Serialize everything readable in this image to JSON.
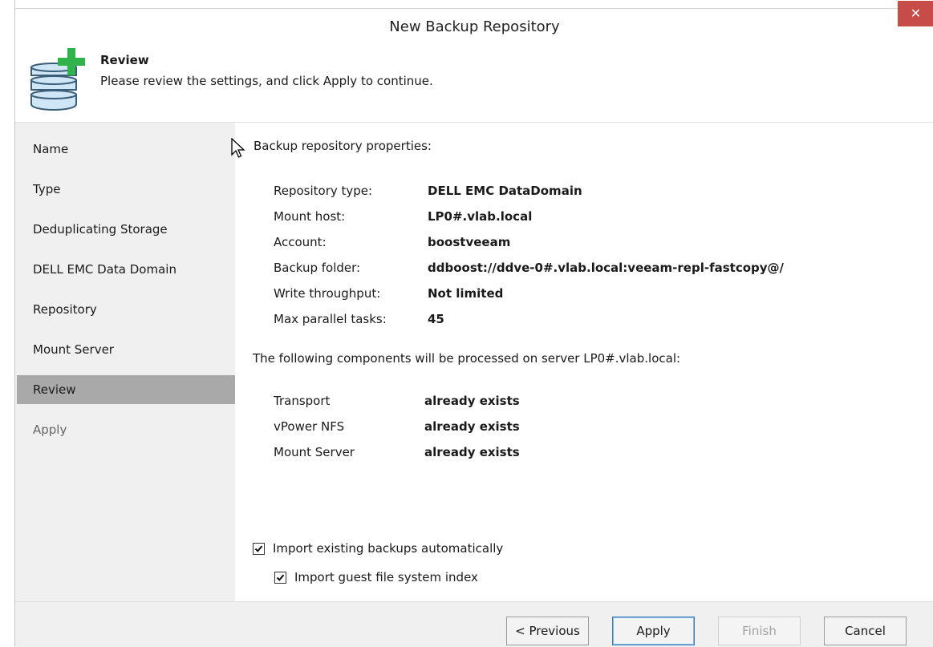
{
  "window": {
    "title": "New Backup Repository",
    "close_symbol": "✕"
  },
  "header": {
    "title": "Review",
    "subtitle": "Please review the settings, and click Apply to continue.",
    "icon": "database-add-icon"
  },
  "sidebar": {
    "items": [
      {
        "label": "Name",
        "state": "normal"
      },
      {
        "label": "Type",
        "state": "normal"
      },
      {
        "label": "Deduplicating Storage",
        "state": "normal"
      },
      {
        "label": "DELL EMC Data Domain",
        "state": "normal"
      },
      {
        "label": "Repository",
        "state": "normal"
      },
      {
        "label": "Mount Server",
        "state": "normal"
      },
      {
        "label": "Review",
        "state": "active"
      },
      {
        "label": "Apply",
        "state": "disabled"
      }
    ]
  },
  "main": {
    "section_title": "Backup repository properties:",
    "properties": [
      {
        "label": "Repository type:",
        "value": "DELL EMC DataDomain"
      },
      {
        "label": "Mount host:",
        "value": "LP0#.vlab.local"
      },
      {
        "label": "Account:",
        "value": "boostveeam"
      },
      {
        "label": "Backup folder:",
        "value": "ddboost://ddve-0#.vlab.local:veeam-repl-fastcopy@/"
      },
      {
        "label": "Write throughput:",
        "value": "Not limited"
      },
      {
        "label": "Max parallel tasks:",
        "value": "45"
      }
    ],
    "components_note": "The following components will be processed on server LP0#.vlab.local:",
    "components": [
      {
        "name": "Transport",
        "status": "already exists"
      },
      {
        "name": "vPower NFS",
        "status": "already exists"
      },
      {
        "name": "Mount Server",
        "status": "already exists"
      }
    ],
    "import_backups": {
      "label": "Import existing backups automatically",
      "checked": true
    },
    "import_index": {
      "label": "Import guest file system index",
      "checked": true
    }
  },
  "footer": {
    "previous_label": "< Previous",
    "apply_label": "Apply",
    "finish_label": "Finish",
    "cancel_label": "Cancel"
  },
  "colors": {
    "close_button": "#c74b47",
    "sidebar_bg": "#f0f0f0",
    "sidebar_active": "#a9a9a9",
    "icon_green": "#2fb34a",
    "icon_blue": "#cfe6f7"
  }
}
